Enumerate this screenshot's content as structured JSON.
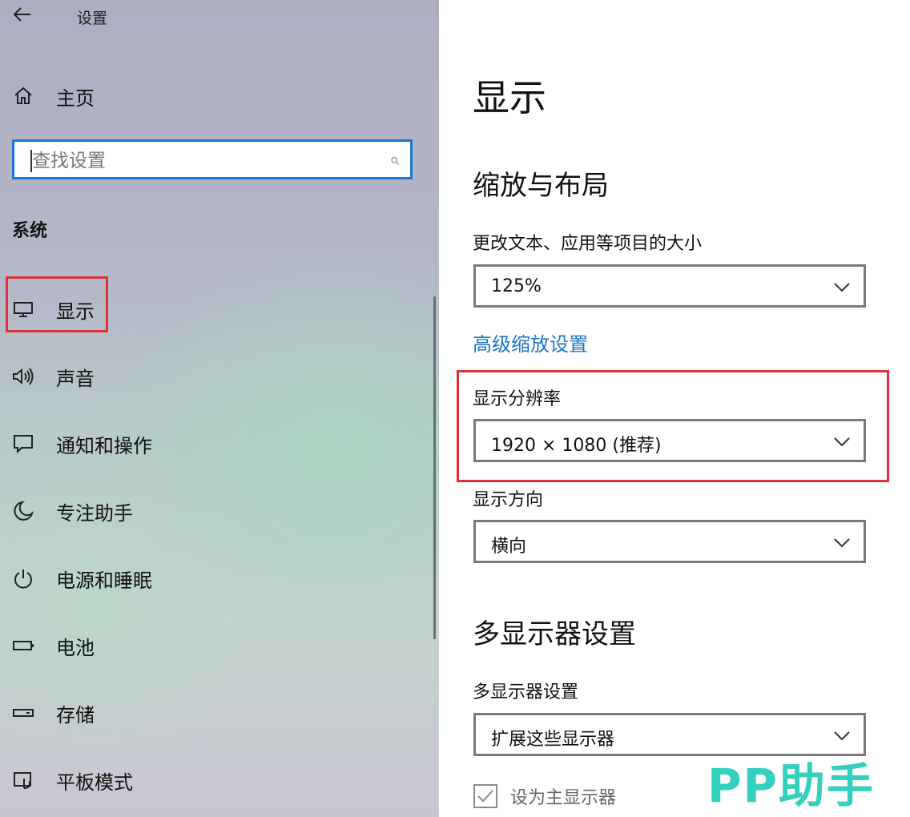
{
  "window": {
    "title": "设置"
  },
  "sidebar": {
    "home_label": "主页",
    "search_placeholder": "查找设置",
    "group_label": "系统",
    "items": [
      {
        "label": "显示",
        "icon": "monitor-icon"
      },
      {
        "label": "声音",
        "icon": "speaker-icon"
      },
      {
        "label": "通知和操作",
        "icon": "message-icon"
      },
      {
        "label": "专注助手",
        "icon": "moon-icon"
      },
      {
        "label": "电源和睡眠",
        "icon": "power-icon"
      },
      {
        "label": "电池",
        "icon": "battery-icon"
      },
      {
        "label": "存储",
        "icon": "storage-icon"
      },
      {
        "label": "平板模式",
        "icon": "tablet-mode-icon"
      }
    ],
    "selected_item": "显示"
  },
  "main": {
    "title": "显示",
    "scale_section": {
      "title": "缩放与布局",
      "scale_label": "更改文本、应用等项目的大小",
      "scale_value": "125%",
      "advanced_link": "高级缩放设置",
      "resolution_label": "显示分辨率",
      "resolution_value": "1920 × 1080 (推荐)",
      "orientation_label": "显示方向",
      "orientation_value": "横向"
    },
    "multi_section": {
      "title": "多显示器设置",
      "label": "多显示器设置",
      "value": "扩展这些显示器",
      "primary_checkbox_label": "设为主显示器",
      "primary_checked": true
    }
  },
  "watermark": "PP助手",
  "colors": {
    "accent": "#1976d2",
    "link": "#1e77c7",
    "highlight_box": "#e0303a",
    "watermark": "#34d0be"
  }
}
